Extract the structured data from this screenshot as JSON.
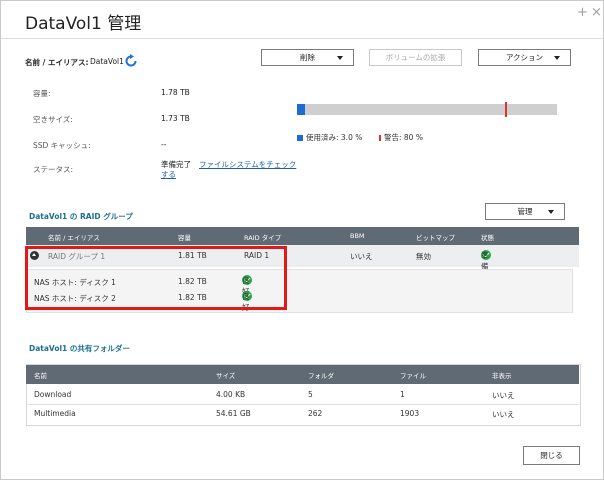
{
  "window": {
    "title": "DataVol1 管理",
    "add_glyph": "+",
    "close_glyph": "×"
  },
  "name_row": {
    "label": "名前 / エイリアス:",
    "value": "DataVol1"
  },
  "toolbar": {
    "delete_label": "削除",
    "expand_label": "ボリュームの拡張",
    "action_label": "アクション"
  },
  "info": {
    "capacity_label": "容量:",
    "capacity_value": "1.78 TB",
    "free_label": "空きサイズ:",
    "free_value": "1.73 TB",
    "ssd_label": "SSD キャッシュ:",
    "ssd_value": "--",
    "status_label": "ステータス:",
    "status_value": "準備完了",
    "fs_check_link_line1": "ファイルシステムをチェック",
    "fs_check_link_line2": "する"
  },
  "usage": {
    "used_fraction": 0.03,
    "warning_fraction": 0.8,
    "used_legend": "使用済み: 3.0 %",
    "warning_legend": "警告: 80 %",
    "used_color": "#1e6bd6",
    "warning_color": "#d9352b"
  },
  "raid": {
    "section_title": "DataVol1 の RAID グループ",
    "manage_label": "管理",
    "headers": {
      "name": "名前 / エイリアス",
      "capacity": "容量",
      "raid_type": "RAID タイプ",
      "bbm": "BBM",
      "bitmap": "ビットマップ",
      "status": "状態"
    },
    "group": {
      "name": "RAID グループ 1",
      "capacity": "1.81 TB",
      "raid_type": "RAID 1",
      "bbm": "いいえ",
      "bitmap": "無効",
      "status": "準備完了"
    },
    "disks": [
      {
        "name": "NAS ホスト: ディスク 1",
        "capacity": "1.82 TB",
        "status": "良好"
      },
      {
        "name": "NAS ホスト: ディスク 2",
        "capacity": "1.82 TB",
        "status": "良好"
      }
    ]
  },
  "shares": {
    "section_title": "DataVol1 の共有フォルダー",
    "headers": {
      "name": "名前",
      "size": "サイズ",
      "folders": "フォルダ",
      "files": "ファイル",
      "hidden": "非表示"
    },
    "rows": [
      {
        "name": "Download",
        "size": "4.00 KB",
        "folders": "5",
        "files": "1",
        "hidden": "いいえ"
      },
      {
        "name": "Multimedia",
        "size": "54.61 GB",
        "folders": "262",
        "files": "1903",
        "hidden": "いいえ"
      }
    ]
  },
  "footer": {
    "close_label": "閉じる"
  }
}
